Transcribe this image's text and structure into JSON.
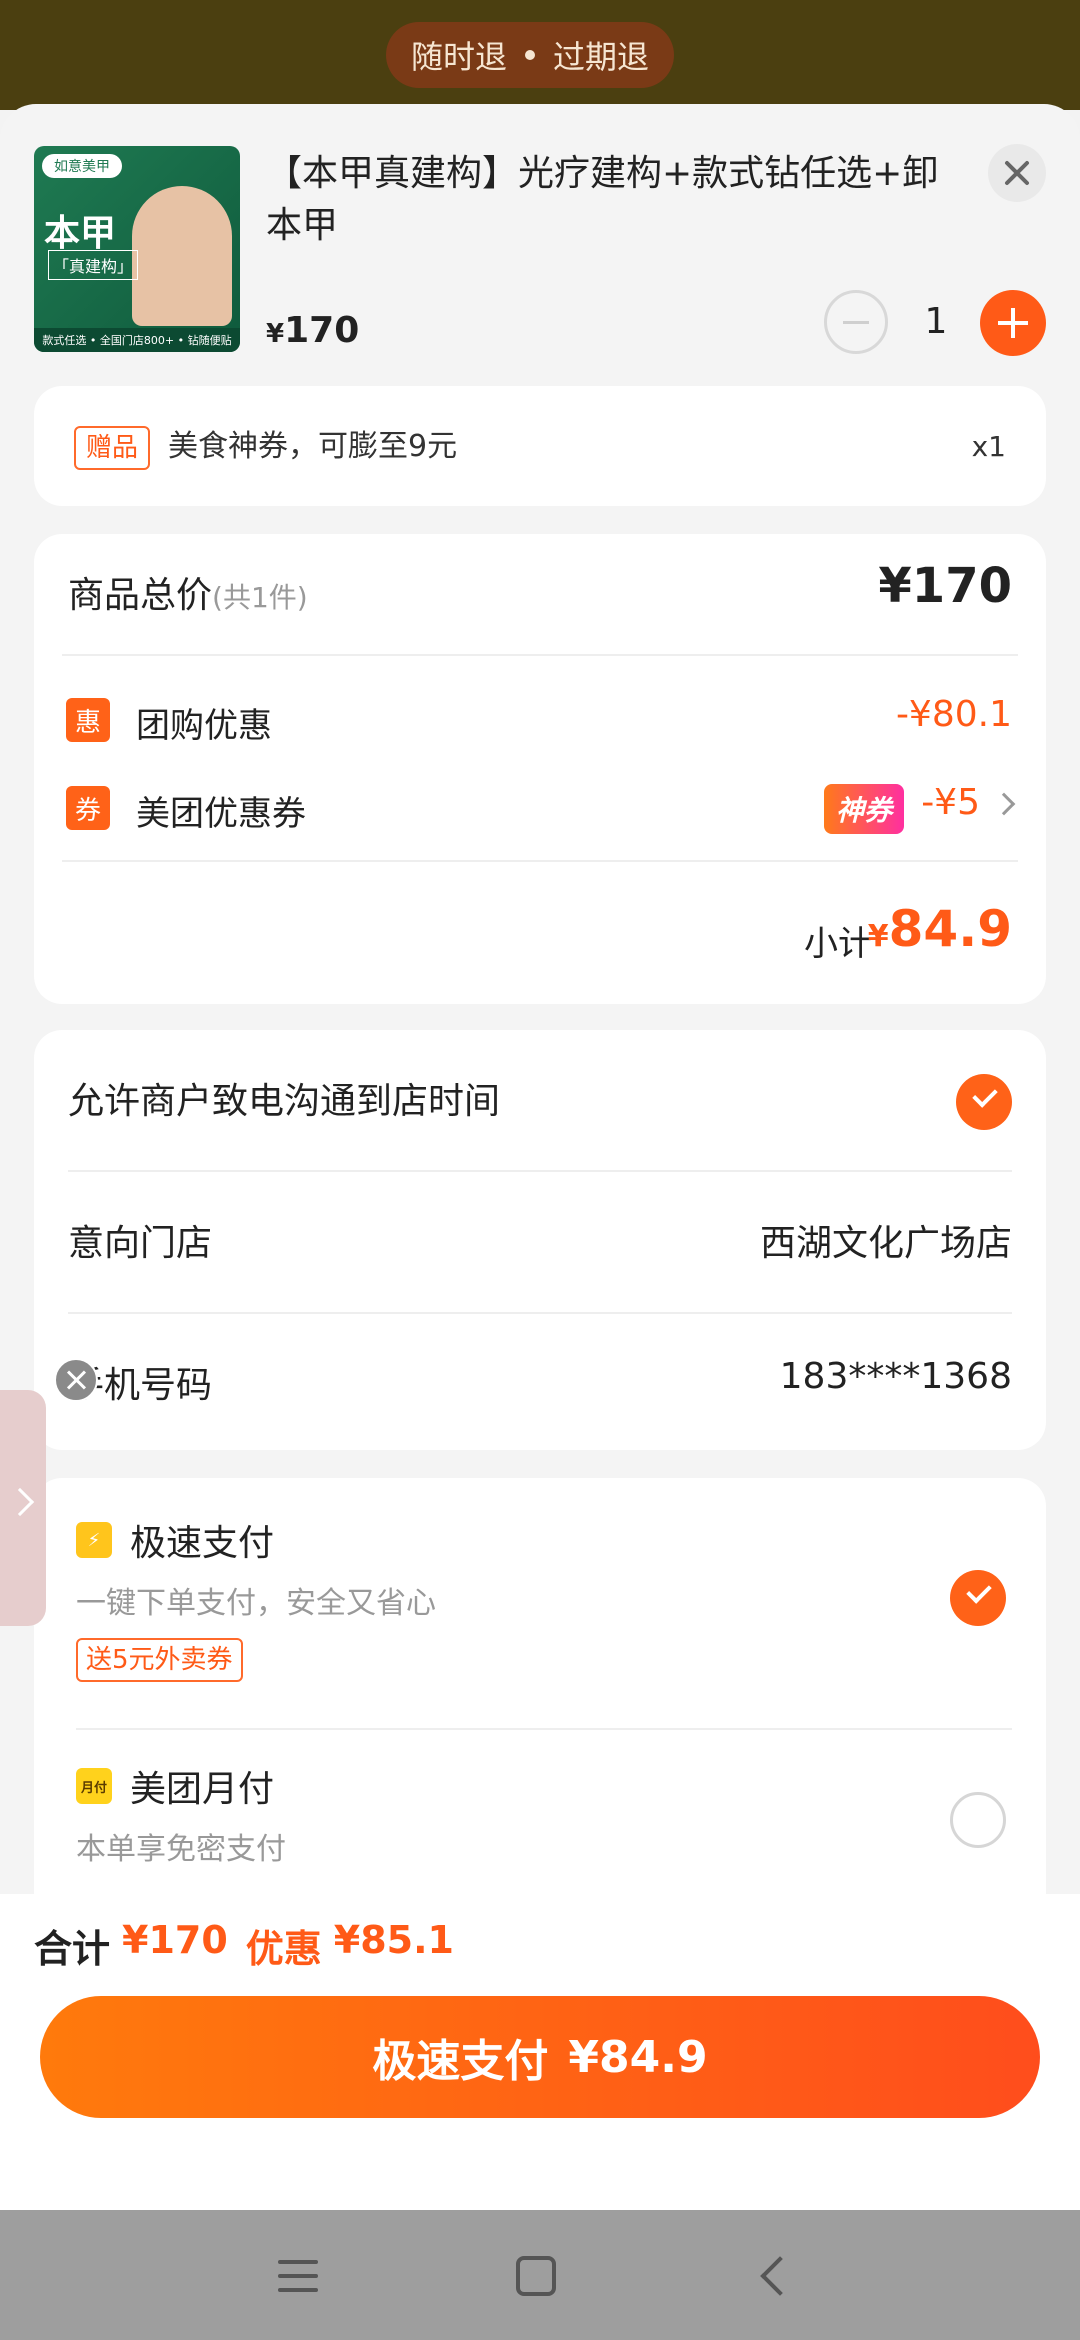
{
  "top_banner": {
    "refund_left": "随时退",
    "refund_right": "过期退"
  },
  "product": {
    "title": "【本甲真建构】光疗建构+款式钻任选+卸本甲",
    "price_symbol": "¥",
    "price": "170",
    "quantity": "1",
    "thumbnail": {
      "brand": "如意美甲",
      "title": "本甲",
      "subtitle": "「真建构」",
      "footer": "款式任选 • 全国门店800+ • 钻随便贴"
    }
  },
  "gift": {
    "badge": "赠品",
    "text": "美食神券，可膨至9元",
    "qty": "x1"
  },
  "summary": {
    "total_label": "商品总价",
    "total_count": "(共1件)",
    "total_value": "¥170",
    "discounts": [
      {
        "icon": "惠",
        "label": "团购优惠",
        "value": "-¥80.1"
      },
      {
        "icon": "券",
        "label": "美团优惠券",
        "value": "-¥5",
        "tag": "神券"
      }
    ],
    "subtotal_label": "小计",
    "subtotal_symbol": "¥",
    "subtotal_value": "84.9"
  },
  "info": {
    "allow_call": "允许商户致电沟通到店时间",
    "store_label": "意向门店",
    "store_value": "西湖文化广场店",
    "phone_label": "手机号码",
    "phone_value": "183****1368"
  },
  "payment": {
    "options": [
      {
        "icon": "⚡",
        "title": "极速支付",
        "subtitle": "一键下单支付，安全又省心",
        "promo": "送5元外卖券",
        "selected": true
      },
      {
        "icon": "月付",
        "title": "美团月付",
        "subtitle": "本单享免密支付",
        "selected": false
      }
    ]
  },
  "footer": {
    "total_label": "合计",
    "total_value": "¥170",
    "discount_label": "优惠",
    "discount_value": "¥85.1",
    "pay_label": "极速支付",
    "pay_amount": "¥84.9"
  },
  "colors": {
    "accent": "#ff5a17",
    "topbar": "#4b3f10"
  }
}
